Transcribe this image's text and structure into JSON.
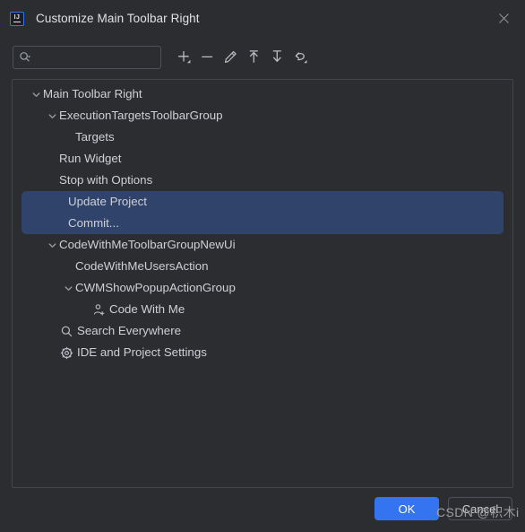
{
  "window": {
    "title": "Customize Main Toolbar Right",
    "logo_icon": "intellij-idea-logo-icon",
    "close_icon": "close-icon"
  },
  "toolbar": {
    "search": {
      "value": "",
      "placeholder": "",
      "icon": "search-with-dropdown-icon"
    },
    "actions": [
      {
        "name": "add-button",
        "icon": "plus-with-dropdown-icon",
        "label": "Add"
      },
      {
        "name": "remove-button",
        "icon": "minus-icon",
        "label": "Remove"
      },
      {
        "name": "edit-button",
        "icon": "pencil-icon",
        "label": "Edit"
      },
      {
        "name": "move-up-button",
        "icon": "arrow-up-icon",
        "label": "Move Up"
      },
      {
        "name": "move-down-button",
        "icon": "arrow-down-icon",
        "label": "Move Down"
      },
      {
        "name": "restore-button",
        "icon": "restore-with-dropdown-icon",
        "label": "Restore"
      }
    ]
  },
  "tree": {
    "rows": [
      {
        "label": "Main Toolbar Right",
        "depth": 0,
        "chevron": "down",
        "icon": null,
        "selected": false
      },
      {
        "label": "ExecutionTargetsToolbarGroup",
        "depth": 1,
        "chevron": "down",
        "icon": null,
        "selected": false
      },
      {
        "label": "Targets",
        "depth": 2,
        "chevron": null,
        "icon": null,
        "selected": false
      },
      {
        "label": "Run Widget",
        "depth": 1,
        "chevron": null,
        "icon": null,
        "selected": false
      },
      {
        "label": "Stop with Options",
        "depth": 1,
        "chevron": null,
        "icon": null,
        "selected": false
      },
      {
        "label": "Update Project",
        "depth": 1,
        "chevron": null,
        "icon": null,
        "selected": true
      },
      {
        "label": "Commit...",
        "depth": 1,
        "chevron": null,
        "icon": null,
        "selected": true
      },
      {
        "label": "CodeWithMeToolbarGroupNewUi",
        "depth": 1,
        "chevron": "down",
        "icon": null,
        "selected": false
      },
      {
        "label": "CodeWithMeUsersAction",
        "depth": 2,
        "chevron": null,
        "icon": null,
        "selected": false
      },
      {
        "label": "CWMShowPopupActionGroup",
        "depth": 2,
        "chevron": "down",
        "icon": null,
        "selected": false
      },
      {
        "label": "Code With Me",
        "depth": 3,
        "chevron": null,
        "icon": "user-plus-icon",
        "selected": false
      },
      {
        "label": "Search Everywhere",
        "depth": 1,
        "chevron": null,
        "icon": "search-icon",
        "selected": false
      },
      {
        "label": "IDE and Project Settings",
        "depth": 1,
        "chevron": null,
        "icon": "gear-icon",
        "selected": false
      }
    ]
  },
  "buttons": {
    "ok": "OK",
    "cancel": "Cancel"
  },
  "watermark": "CSDN @积木i",
  "colors": {
    "dialog_bg": "#2B2D30",
    "panel_border": "#43454A",
    "text": "#CED0D6",
    "selection": "#2F436B",
    "accent": "#3574F0"
  }
}
